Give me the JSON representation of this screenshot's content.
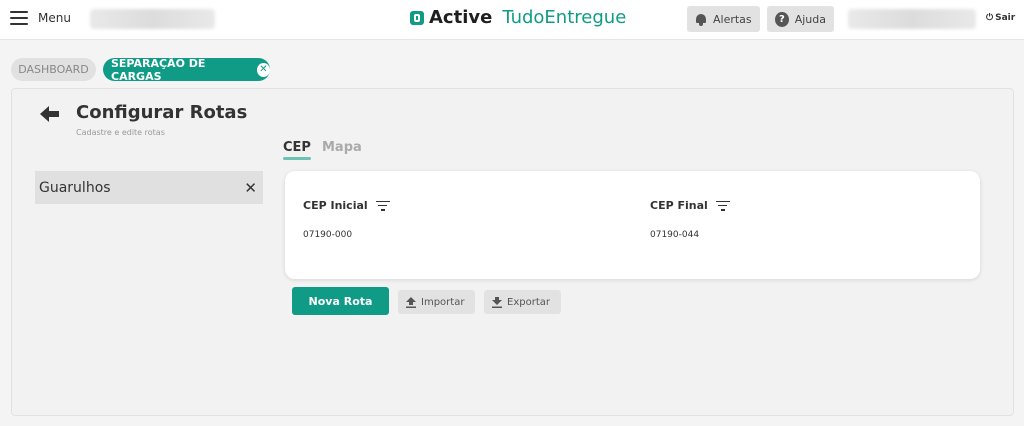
{
  "header": {
    "menu_label": "Menu",
    "logo_bold": "Active",
    "logo_light": "TudoEntregue",
    "alerts_label": "Alertas",
    "help_label": "Ajuda",
    "logout_label": "Sair"
  },
  "breadcrumbs": [
    {
      "label": "DASHBOARD"
    },
    {
      "label": "SEPARAÇÃO DE CARGAS"
    }
  ],
  "page": {
    "title": "Configurar Rotas",
    "subtitle": "Cadastre e edite rotas"
  },
  "sidebar": {
    "items": [
      {
        "label": "Guarulhos"
      }
    ]
  },
  "tabs": [
    {
      "label": "CEP",
      "active": true
    },
    {
      "label": "Mapa",
      "active": false
    }
  ],
  "table": {
    "columns": [
      {
        "label": "CEP Inicial"
      },
      {
        "label": "CEP Final"
      }
    ],
    "rows": [
      [
        "07190-000",
        "07190-044"
      ]
    ]
  },
  "actions": {
    "new_route": "Nova Rota",
    "import": "Importar",
    "export": "Exportar"
  },
  "colors": {
    "accent": "#0f9b86",
    "tab_underline": "#6cc3b4"
  },
  "icons": [
    "menu-icon",
    "logo-icon",
    "bell-icon",
    "help-icon",
    "power-icon",
    "close-icon",
    "back-arrow-icon",
    "filter-icon",
    "upload-icon",
    "download-icon"
  ]
}
